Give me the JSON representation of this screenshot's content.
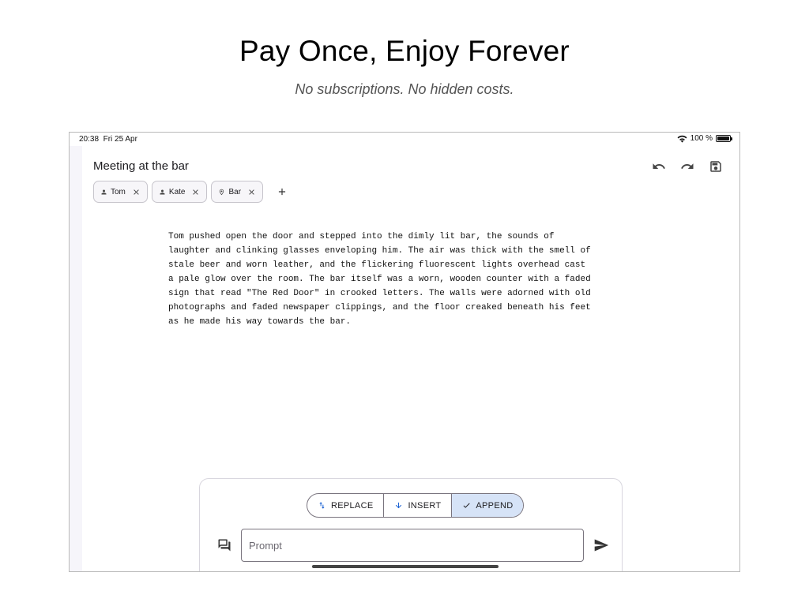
{
  "hero": {
    "title": "Pay Once, Enjoy Forever",
    "subtitle": "No subscriptions. No hidden costs."
  },
  "status_bar": {
    "time": "20:38",
    "date": "Fri 25 Apr",
    "battery": "100 %",
    "icons": [
      "wifi-icon",
      "battery-icon"
    ]
  },
  "document": {
    "title": "Meeting at the bar",
    "toolbar": [
      "undo-icon",
      "redo-icon",
      "save-icon"
    ],
    "chips": [
      {
        "label": "Tom",
        "icon": "person-icon"
      },
      {
        "label": "Kate",
        "icon": "person-icon"
      },
      {
        "label": "Bar",
        "icon": "location-pin-icon"
      }
    ],
    "body": "Tom pushed open the door and stepped into the dimly lit bar, the sounds of\nlaughter and clinking glasses enveloping him. The air was thick with the smell of\nstale beer and worn leather, and the flickering fluorescent lights overhead cast\na pale glow over the room. The bar itself was a worn, wooden counter with a faded\nsign that read \"The Red Door\" in crooked letters. The walls were adorned with old\nphotographs and faded newspaper clippings, and the floor creaked beneath his feet\nas he made his way towards the bar."
  },
  "prompt_panel": {
    "modes": [
      {
        "label": "REPLACE",
        "icon": "swap-vertical-icon",
        "selected": false
      },
      {
        "label": "INSERT",
        "icon": "arrow-down-icon",
        "selected": false
      },
      {
        "label": "APPEND",
        "icon": "check-icon",
        "selected": true
      }
    ],
    "input_placeholder": "Prompt",
    "input_value": ""
  },
  "colors": {
    "selected_segment": "#d6e3f7",
    "outline": "#79747e",
    "side_rail": "#f6f5fa"
  }
}
